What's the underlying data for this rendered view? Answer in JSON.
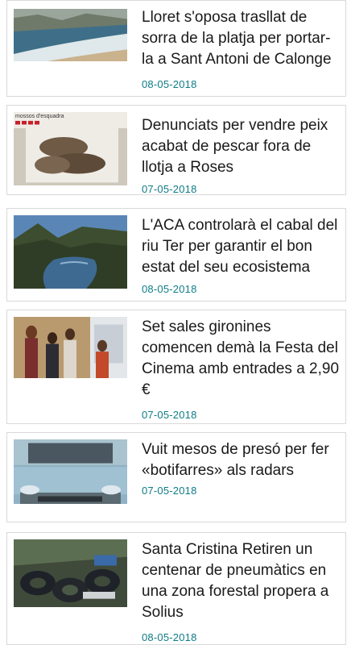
{
  "articles": [
    {
      "title": "Lloret s'oposa trasllat de sorra de la platja per portar-la a Sant Antoni de Calonge",
      "date": "08-05-2018",
      "image": "beach-photo"
    },
    {
      "title": "Denunciats per vendre peix acabat de pescar fora de llotja a Roses",
      "date": "07-05-2018",
      "image": "fish-in-box-photo",
      "image_caption": "mossos d'esquadra"
    },
    {
      "title": "L'ACA controlarà el cabal del riu Ter per garantir el bon estat del seu ecosistema",
      "date": "08-05-2018",
      "image": "river-photo"
    },
    {
      "title": "Set sales gironines comencen demà la Festa del Cinema amb entrades a 2,90 €",
      "date": "07-05-2018",
      "image": "cinema-people-photo"
    },
    {
      "title": "Vuit mesos de presó per fer «botifarres» als radars",
      "date": "07-05-2018",
      "image": "car-photo"
    },
    {
      "title": "Santa Cristina Retiren un centenar de pneumàtics en una zona forestal propera a Solius",
      "date": "08-05-2018",
      "image": "tires-in-forest-photo"
    }
  ]
}
